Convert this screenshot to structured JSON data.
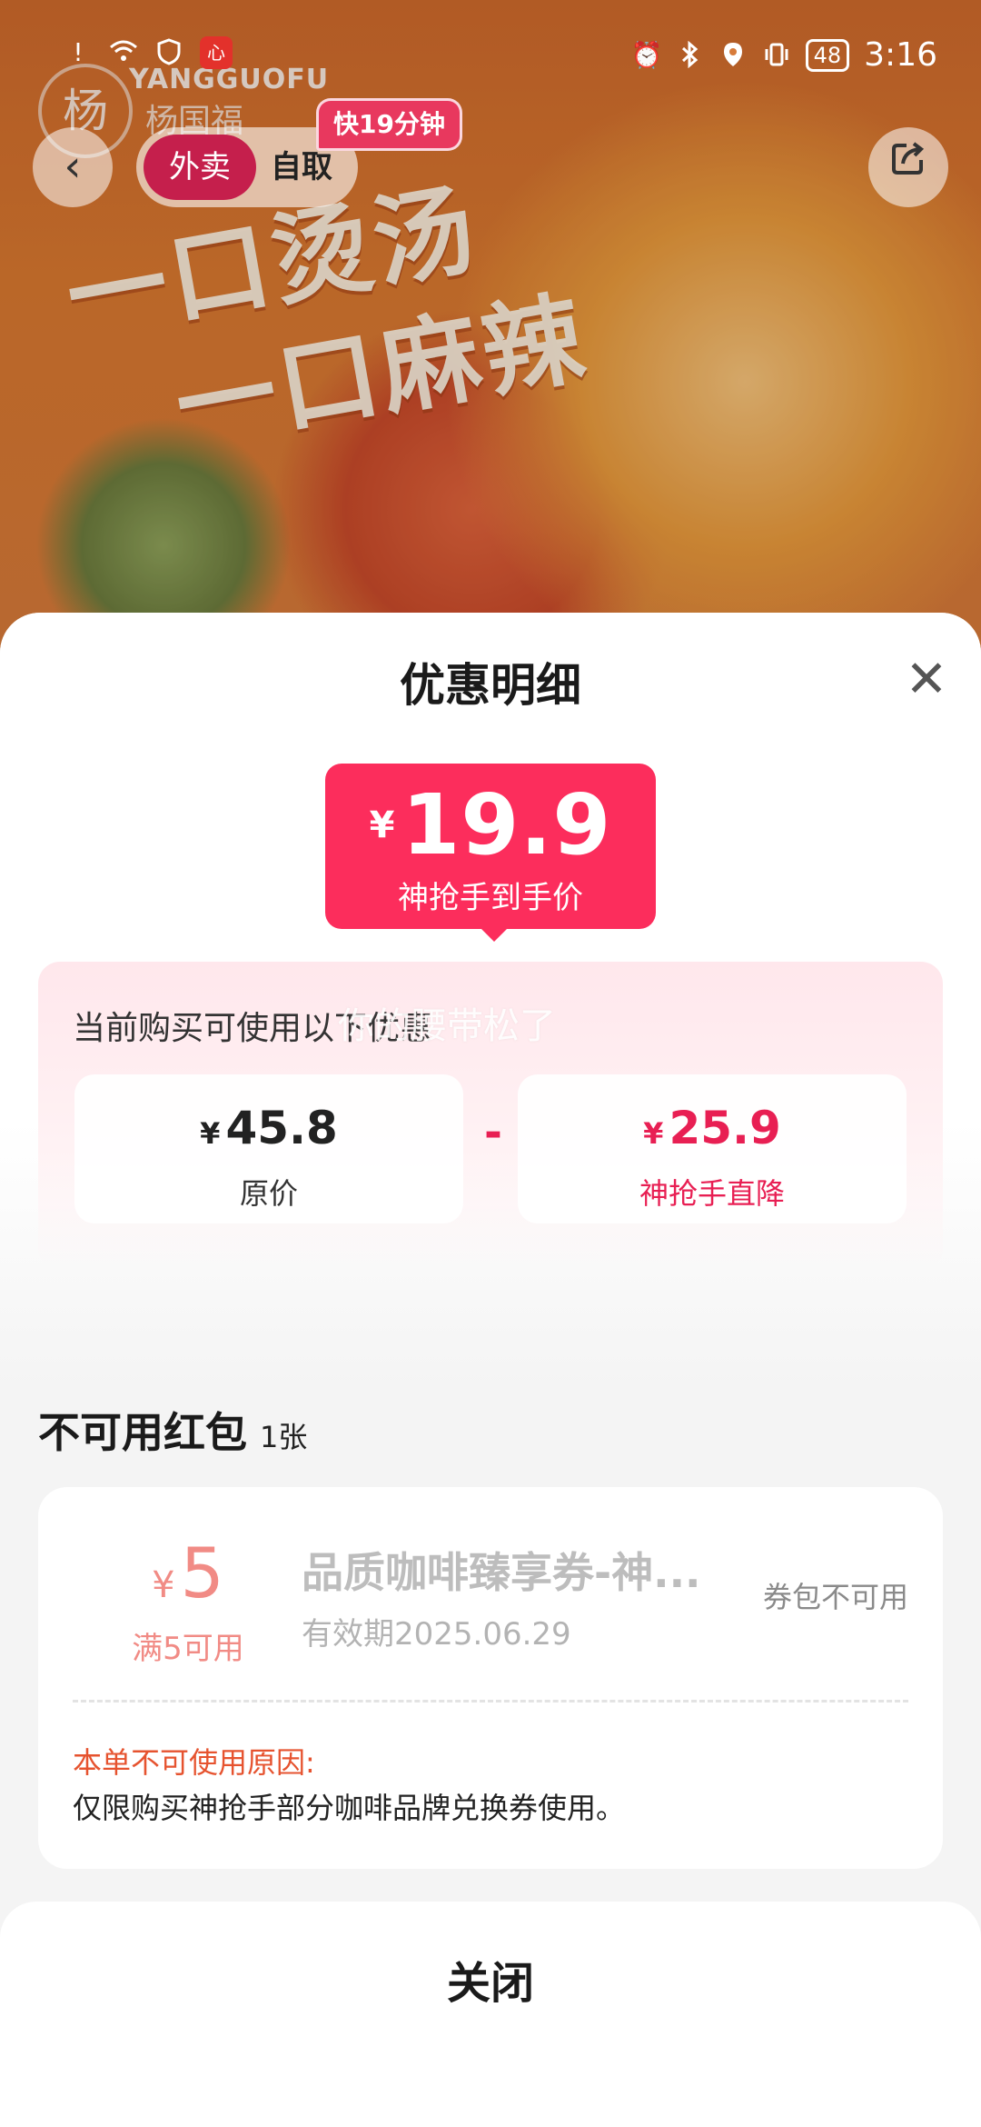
{
  "status_bar": {
    "time": "3:16",
    "battery": "48",
    "app_badge": "心"
  },
  "banner": {
    "brand_en": "YANGGUOFU",
    "brand_cn": "杨国福",
    "brand_mark": "杨",
    "slogan_line1": "一口烫汤",
    "slogan_line2": "一口麻辣"
  },
  "nav": {
    "delivery_label": "外卖",
    "pickup_label": "自取",
    "eta_badge": "快19分钟"
  },
  "sheet": {
    "title": "优惠明细",
    "final_price": {
      "currency": "¥",
      "value": "19.9",
      "label": "神抢手到手价"
    },
    "discount_caption": "当前购买可使用以下优惠",
    "watermark": "你的腰带松了",
    "original": {
      "currency": "¥",
      "value": "45.8",
      "label": "原价"
    },
    "operator": "-",
    "drop": {
      "currency": "¥",
      "value": "25.9",
      "label": "神抢手直降"
    },
    "unusable": {
      "title": "不可用红包",
      "count": "1张"
    },
    "coupon": {
      "currency": "¥",
      "amount": "5",
      "condition": "满5可用",
      "name": "品质咖啡臻享券-神...",
      "validity": "有效期2025.06.29",
      "status": "券包不可用",
      "reason_label": "本单不可使用原因:",
      "reason_text": "仅限购买神抢手部分咖啡品牌兑换券使用。"
    },
    "close_button": "关闭"
  },
  "colors": {
    "accent": "#fc2d5c",
    "accent_text": "#e81f53",
    "coupon_text": "#f18b85",
    "reason": "#e6532f"
  }
}
